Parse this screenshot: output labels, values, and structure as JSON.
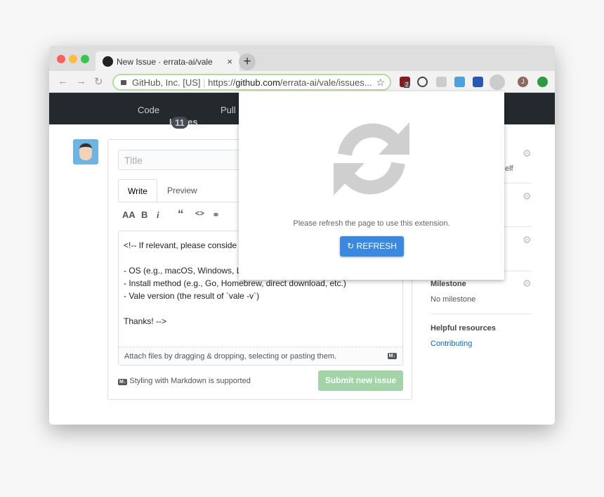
{
  "browser": {
    "tab_title": "New Issue · errata-ai/vale",
    "new_tab": "+",
    "close": "×",
    "back": "←",
    "forward": "→",
    "reload": "↻",
    "site_identity": "GitHub, Inc. [US]",
    "url_prefix": "https://",
    "url_domain": "github.com",
    "url_path": "/errata-ai/vale/issues...",
    "bookmark": "☆",
    "ext_badge": "2",
    "profile_initial": "J"
  },
  "repo_nav": {
    "code": "Code",
    "issues": "Issues",
    "issues_count": "11",
    "pulls": "Pull r"
  },
  "form": {
    "title_placeholder": "Title",
    "tabs": [
      "Write",
      "Preview"
    ],
    "toolbar": {
      "heading": "AA",
      "bold": "B",
      "italic": "i",
      "quote": "“",
      "code": "<>",
      "link": "⚭"
    },
    "body": "<!-- If relevant, please conside\n\n- OS (e.g., macOS, Windows, L\n- Install method (e.g., Go, Homebrew, direct download, etc.)\n- Vale version (the result of `vale -v`)\n\nThanks! -->",
    "attach_hint": "Attach files by dragging & dropping, selecting or pasting them.",
    "md_badge": "M↓",
    "markdown_note": "Styling with Markdown is supported",
    "submit": "Submit new issue"
  },
  "sidebar": {
    "assignee_fragment": "elf",
    "milestone_heading": "Milestone",
    "milestone_value": "No milestone",
    "resources_heading": "Helpful resources",
    "contributing": "Contributing",
    "gear": "⚙"
  },
  "popup": {
    "message": "Please refresh the page to use this extension.",
    "refresh_icon": "↻",
    "refresh": "REFRESH"
  }
}
